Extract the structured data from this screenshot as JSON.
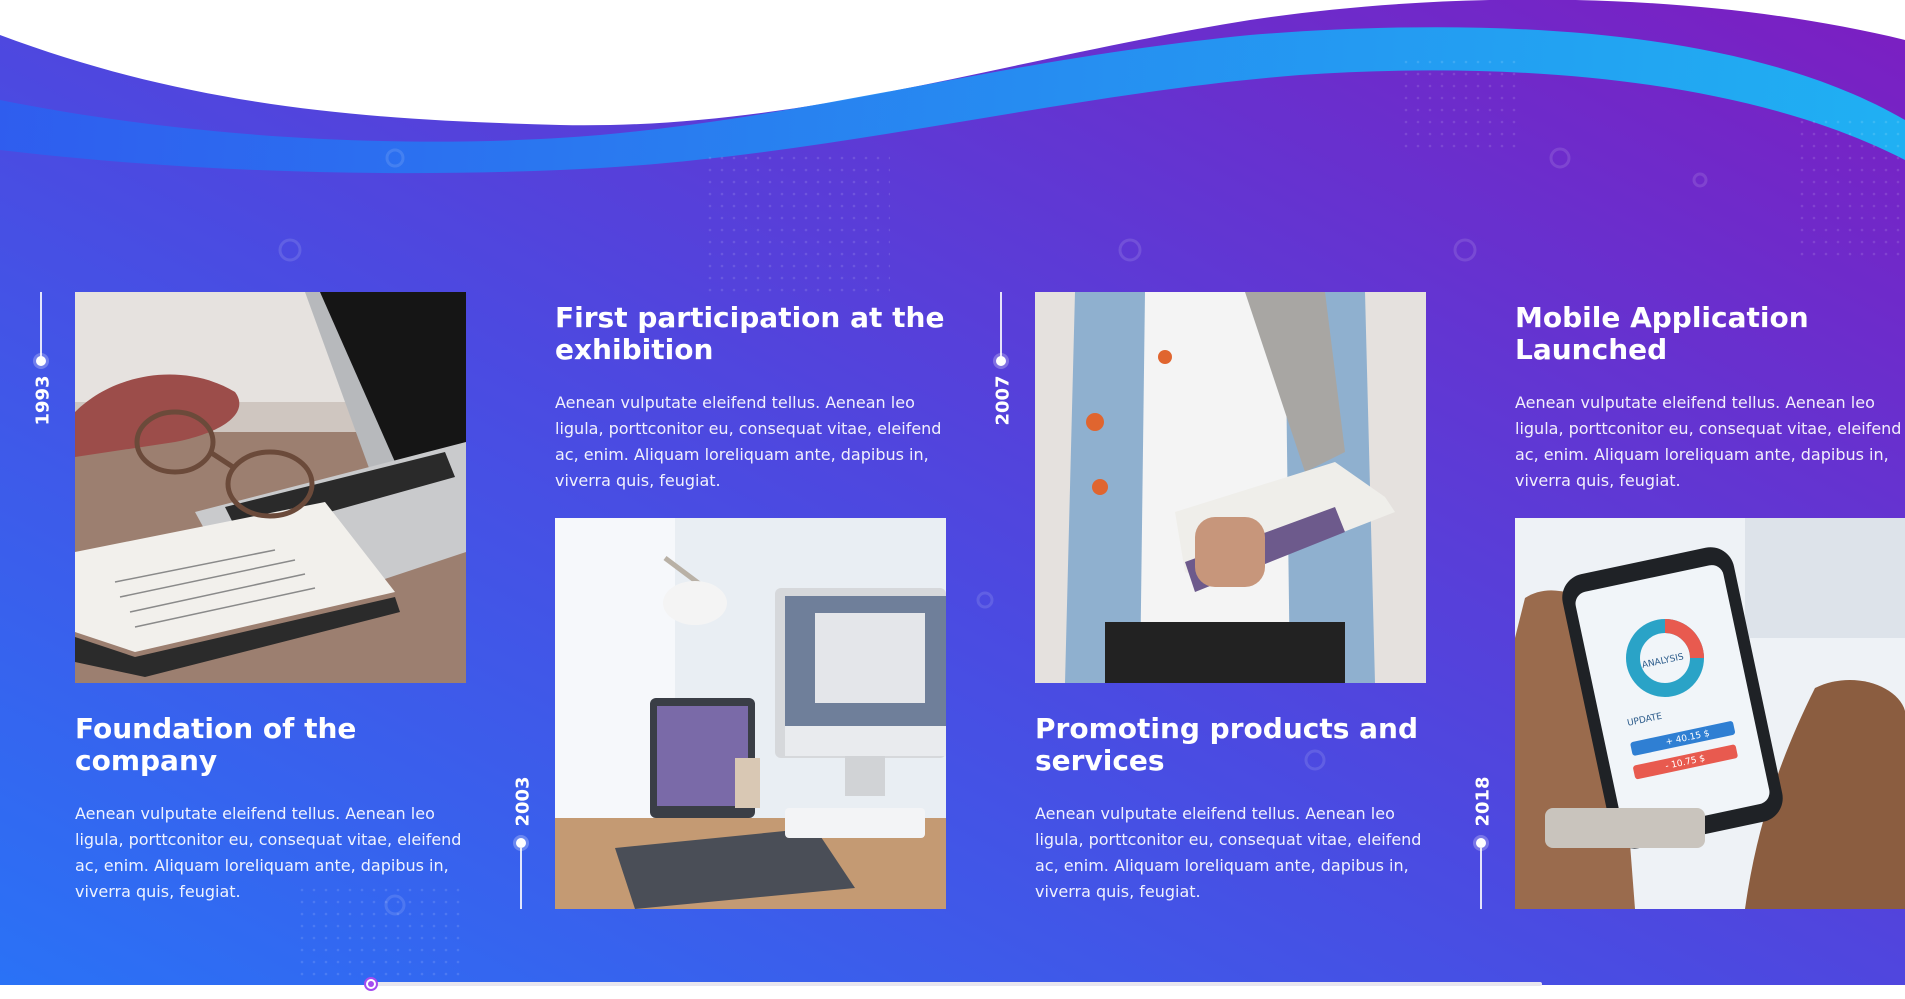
{
  "colors": {
    "gradient_left": "#2d6cf5",
    "gradient_mid": "#4a4be0",
    "gradient_right": "#7a1fc2",
    "wave_cyan": "#1ab6f5",
    "slider_accent": "#a44cf0"
  },
  "timeline": [
    {
      "year": "1993",
      "title": "Foundation of the company",
      "description": "Aenean vulputate eleifend tellus. Aenean leo ligula, porttconitor eu, consequat vitae, eleifend ac, enim. Aliquam loreliquam ante, dapibus in, viverra quis, feugiat.",
      "image": "laptop-notebook-glasses-photo"
    },
    {
      "year": "2003",
      "title": "First participation at the exhibition",
      "description": "Aenean vulputate eleifend tellus. Aenean leo ligula, porttconitor eu, consequat vitae, eleifend ac, enim. Aliquam loreliquam ante, dapibus in, viverra quis, feugiat.",
      "image": "desktop-workspace-photo"
    },
    {
      "year": "2007",
      "title": "Promoting products and services",
      "description": "Aenean vulputate eleifend tellus. Aenean leo ligula, porttconitor eu, consequat vitae, eleifend ac, enim. Aliquam loreliquam ante, dapibus in, viverra quis, feugiat.",
      "image": "student-with-books-photo"
    },
    {
      "year": "2018",
      "title": "Mobile Application Launched",
      "description": "Aenean vulputate eleifend tellus. Aenean leo ligula, porttconitor eu, consequat vitae, eleifend ac, enim. Aliquam loreliquam ante, dapibus in, viverra quis, feugiat.",
      "image": "phone-analytics-app-photo",
      "phone_labels": {
        "chart": "ANALYSIS",
        "update": "UPDATE",
        "value1": "+ 40.15 $",
        "value2": "- 10.75 $"
      }
    }
  ],
  "slider": {
    "position": 0
  }
}
